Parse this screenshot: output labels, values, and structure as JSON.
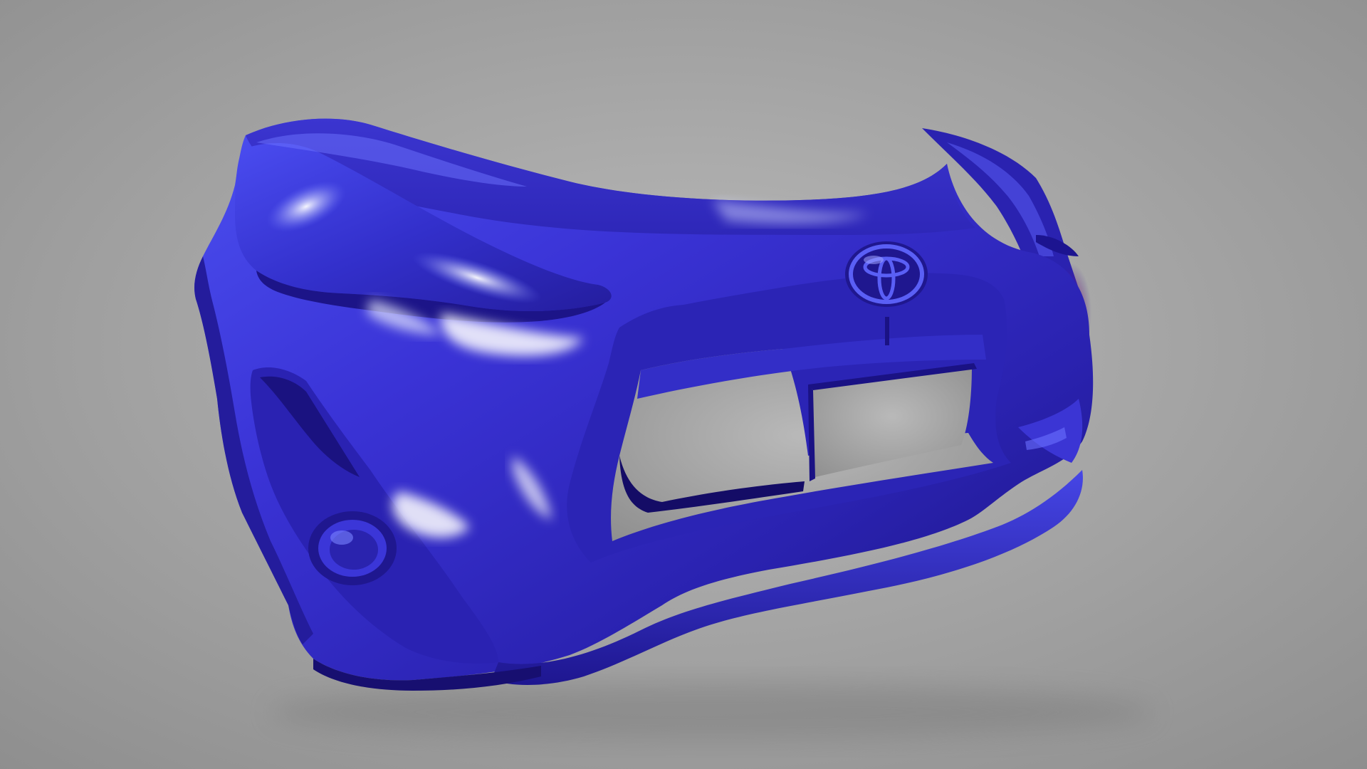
{
  "scene": {
    "subject": "car-front-bumper-3d-model",
    "icon": "toyota-emblem-icon"
  },
  "colors": {
    "background_center": "#b9b9b9",
    "background_edge": "#8e8e8e",
    "paint_light": "#6a73ff",
    "paint_mid": "#3a33d6",
    "paint_dark": "#1f178f",
    "paint_deep": "#120c5e",
    "highlight": "#f2f4ff",
    "inner_red": "#b0144a"
  }
}
